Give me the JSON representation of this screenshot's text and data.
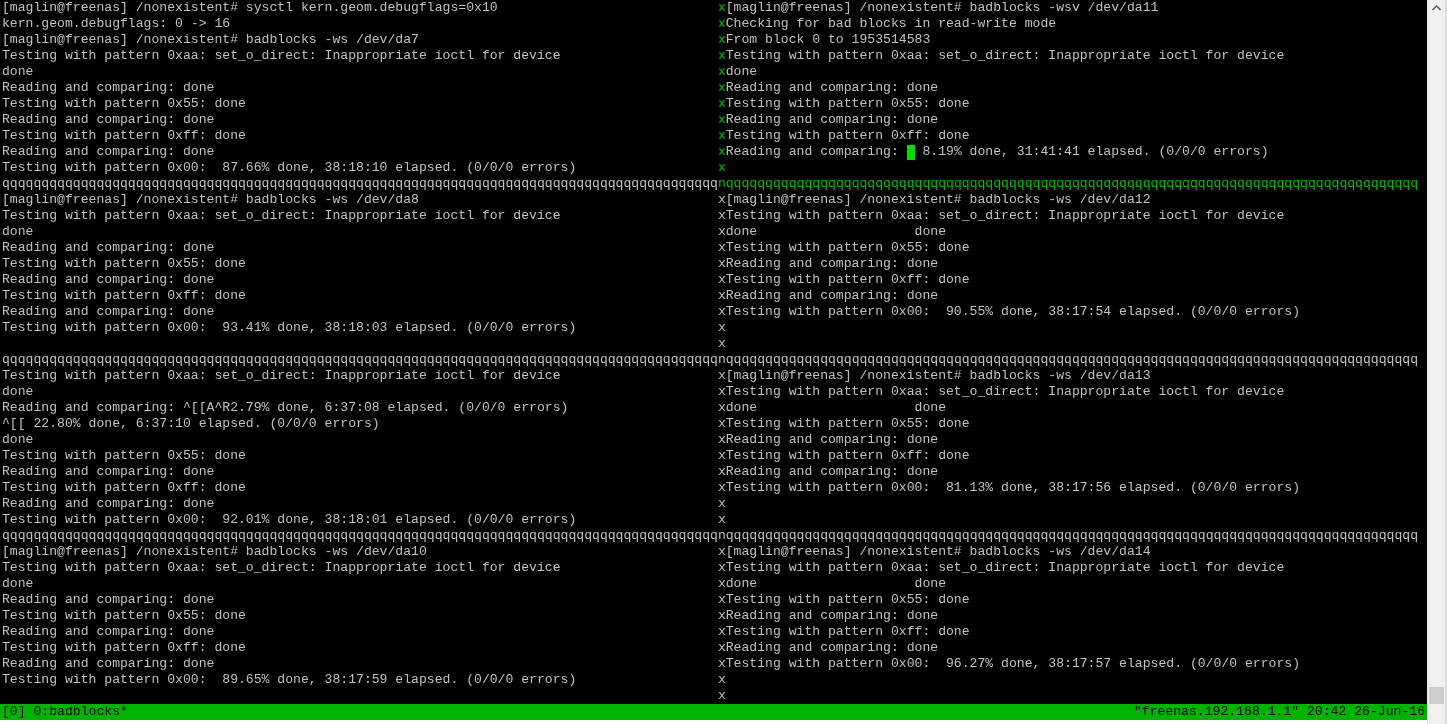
{
  "bands": [
    {
      "left": {
        "lines": [
          {
            "text": "[maglin@freenas] /nonexistent# sysctl kern.geom.debugflags=0x10"
          },
          {
            "text": "kern.geom.debugflags: 0 -> 16"
          },
          {
            "text": "[maglin@freenas] /nonexistent# badblocks -ws /dev/da7"
          },
          {
            "text": "Testing with pattern 0xaa: set_o_direct: Inappropriate ioctl for device"
          },
          {
            "text": "done"
          },
          {
            "text": "Reading and comparing: done"
          },
          {
            "text": "Testing with pattern 0x55: done"
          },
          {
            "text": "Reading and comparing: done"
          },
          {
            "text": "Testing with pattern 0xff: done"
          },
          {
            "text": "Reading and comparing: done"
          },
          {
            "text": "Testing with pattern 0x00:  87.66% done, 38:18:10 elapsed. (0/0/0 errors)"
          }
        ]
      },
      "border": "xxxxxxxxxxx",
      "right": {
        "active": true,
        "lines": [
          {
            "text": "[maglin@freenas] /nonexistent# badblocks -wsv /dev/da11"
          },
          {
            "text": "Checking for bad blocks in read-write mode"
          },
          {
            "text": "From block 0 to 1953514583"
          },
          {
            "text": "Testing with pattern 0xaa: set_o_direct: Inappropriate ioctl for device"
          },
          {
            "text": "done"
          },
          {
            "text": "Reading and comparing: done"
          },
          {
            "text": "Testing with pattern 0x55: done"
          },
          {
            "text": "Reading and comparing: done"
          },
          {
            "text": "Testing with pattern 0xff: done"
          },
          {
            "text": "Reading and comparing: ",
            "after_cursor": " 8.19% done, 31:41:41 elapsed. (0/0/0 errors)"
          }
        ]
      },
      "divider": {
        "left": "qqqqqqqqqqqqqqqqqqqqqqqqqqqqqqqqqqqqqqqqqqqqqqqqqqqqqqqqqqqqqqqqqqqqqqqqqqqqqqqqqqqqqqqqqqq",
        "right": "nqqqqqqqqqqqqqqqqqqqqqqqqqqqqqqqqqqqqqqqqqqqqqqqqqqqqqqqqqqqqqqqqqqqqqqqqqqqqqqqqqqqqqqqq"
      }
    },
    {
      "left": {
        "lines": [
          {
            "text": "[maglin@freenas] /nonexistent# badblocks -ws /dev/da8"
          },
          {
            "text": "Testing with pattern 0xaa: set_o_direct: Inappropriate ioctl for device"
          },
          {
            "text": "done"
          },
          {
            "text": "Reading and comparing: done"
          },
          {
            "text": "Testing with pattern 0x55: done"
          },
          {
            "text": "Reading and comparing: done"
          },
          {
            "text": "Testing with pattern 0xff: done"
          },
          {
            "text": "Reading and comparing: done"
          },
          {
            "text": "Testing with pattern 0x00:  93.41% done, 38:18:03 elapsed. (0/0/0 errors)"
          }
        ]
      },
      "border": "xxxxxxxxxx",
      "right": {
        "active": false,
        "lines": [
          {
            "text": "[maglin@freenas] /nonexistent# badblocks -ws /dev/da12"
          },
          {
            "text": "Testing with pattern 0xaa: set_o_direct: Inappropriate ioctl for device"
          },
          {
            "text": "done                    done"
          },
          {
            "text": "Testing with pattern 0x55: done"
          },
          {
            "text": "Reading and comparing: done"
          },
          {
            "text": "Testing with pattern 0xff: done"
          },
          {
            "text": "Reading and comparing: done"
          },
          {
            "text": "Testing with pattern 0x00:  90.55% done, 38:17:54 elapsed. (0/0/0 errors)"
          }
        ]
      },
      "divider": {
        "left": "qqqqqqqqqqqqqqqqqqqqqqqqqqqqqqqqqqqqqqqqqqqqqqqqqqqqqqqqqqqqqqqqqqqqqqqqqqqqqqqqqqqqqqqqqqq",
        "right": "nqqqqqqqqqqqqqqqqqqqqqqqqqqqqqqqqqqqqqqqqqqqqqqqqqqqqqqqqqqqqqqqqqqqqqqqqqqqqqqqqqqqqqqqq"
      }
    },
    {
      "left": {
        "lines": [
          {
            "text": "Testing with pattern 0xaa: set_o_direct: Inappropriate ioctl for device"
          },
          {
            "text": "done"
          },
          {
            "text": "Reading and comparing: ^[[A^R2.79% done, 6:37:08 elapsed. (0/0/0 errors)"
          },
          {
            "text": "^[[ 22.80% done, 6:37:10 elapsed. (0/0/0 errors)"
          },
          {
            "text": "done"
          },
          {
            "text": "Testing with pattern 0x55: done"
          },
          {
            "text": "Reading and comparing: done"
          },
          {
            "text": "Testing with pattern 0xff: done"
          },
          {
            "text": "Reading and comparing: done"
          },
          {
            "text": "Testing with pattern 0x00:  92.01% done, 38:18:01 elapsed. (0/0/0 errors)"
          }
        ]
      },
      "border": "xxxxxxxxxx",
      "right": {
        "active": false,
        "lines": [
          {
            "text": "[maglin@freenas] /nonexistent# badblocks -ws /dev/da13"
          },
          {
            "text": "Testing with pattern 0xaa: set_o_direct: Inappropriate ioctl for device"
          },
          {
            "text": "done                    done"
          },
          {
            "text": "Testing with pattern 0x55: done"
          },
          {
            "text": "Reading and comparing: done"
          },
          {
            "text": "Testing with pattern 0xff: done"
          },
          {
            "text": "Reading and comparing: done"
          },
          {
            "text": "Testing with pattern 0x00:  81.13% done, 38:17:56 elapsed. (0/0/0 errors)"
          }
        ]
      },
      "divider": {
        "left": "qqqqqqqqqqqqqqqqqqqqqqqqqqqqqqqqqqqqqqqqqqqqqqqqqqqqqqqqqqqqqqqqqqqqqqqqqqqqqqqqqqqqqqqqqqq",
        "right": "nqqqqqqqqqqqqqqqqqqqqqqqqqqqqqqqqqqqqqqqqqqqqqqqqqqqqqqqqqqqqqqqqqqqqqqqqqqqqqqqqqqqqqqqq"
      }
    },
    {
      "left": {
        "lines": [
          {
            "text": "[maglin@freenas] /nonexistent# badblocks -ws /dev/da10"
          },
          {
            "text": "Testing with pattern 0xaa: set_o_direct: Inappropriate ioctl for device"
          },
          {
            "text": "done"
          },
          {
            "text": "Reading and comparing: done"
          },
          {
            "text": "Testing with pattern 0x55: done"
          },
          {
            "text": "Reading and comparing: done"
          },
          {
            "text": "Testing with pattern 0xff: done"
          },
          {
            "text": "Reading and comparing: done"
          },
          {
            "text": "Testing with pattern 0x00:  89.65% done, 38:17:59 elapsed. (0/0/0 errors)"
          }
        ]
      },
      "border": "xxxxxxxxxx",
      "right": {
        "active": false,
        "lines": [
          {
            "text": "[maglin@freenas] /nonexistent# badblocks -ws /dev/da14"
          },
          {
            "text": "Testing with pattern 0xaa: set_o_direct: Inappropriate ioctl for device"
          },
          {
            "text": "done                    done"
          },
          {
            "text": "Testing with pattern 0x55: done"
          },
          {
            "text": "Reading and comparing: done"
          },
          {
            "text": "Testing with pattern 0xff: done"
          },
          {
            "text": "Reading and comparing: done"
          },
          {
            "text": "Testing with pattern 0x00:  96.27% done, 38:17:57 elapsed. (0/0/0 errors)"
          }
        ]
      }
    }
  ],
  "status_bar": {
    "windows": "[0] 0:badblocks*",
    "info": "\"freenas.192.168.1.1\" 20:42 26-Jun-16"
  }
}
